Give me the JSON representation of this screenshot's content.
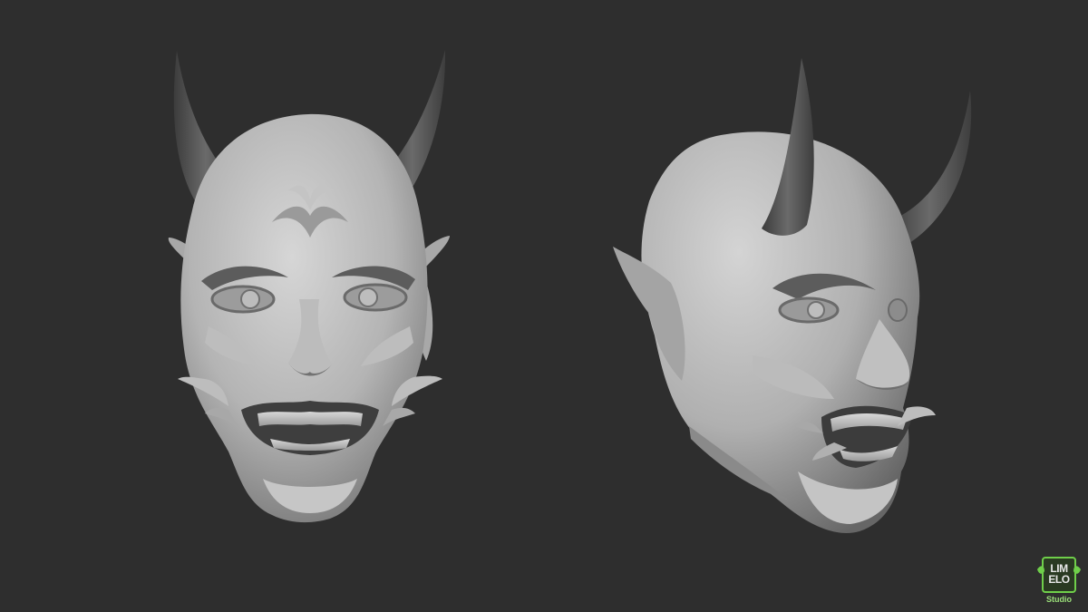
{
  "scene": {
    "subject": "hannya-mask-sculpt",
    "views": [
      "front-view",
      "three-quarter-view"
    ],
    "colors": {
      "background": "#2e2e2e",
      "clay_light": "#d2d2d2",
      "clay_mid": "#a2a2a2",
      "clay_dark": "#5a5a5a",
      "horn_dark": "#565656",
      "logo_green": "#6fcf4a"
    }
  },
  "watermark": {
    "line1": "LIM",
    "line2": "ELO",
    "line3": "Studio"
  }
}
